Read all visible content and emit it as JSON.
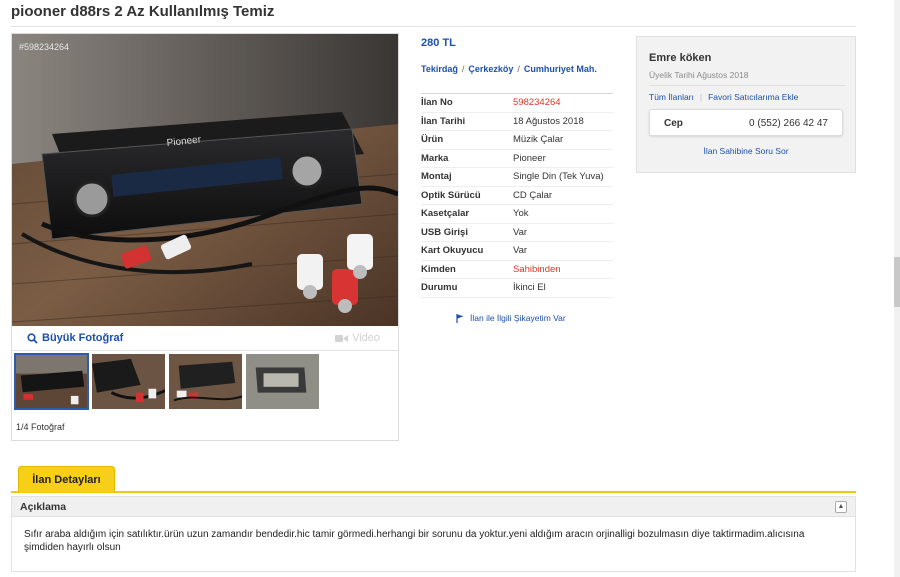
{
  "listing": {
    "title": "piooner d88rs 2 Az Kullanılmış Temiz",
    "photo_id": "#598234264",
    "price": "280 TL",
    "location": {
      "city": "Tekirdağ",
      "district": "Çerkezköy",
      "neighborhood": "Cumhuriyet Mah.",
      "separator": "/"
    },
    "details": [
      {
        "key": "İlan No",
        "value": "598234264",
        "highlight": true
      },
      {
        "key": "İlan Tarihi",
        "value": "18 Ağustos 2018",
        "highlight": false
      },
      {
        "key": "Ürün",
        "value": "Müzik Çalar",
        "highlight": false
      },
      {
        "key": "Marka",
        "value": "Pioneer",
        "highlight": false
      },
      {
        "key": "Montaj",
        "value": "Single Din (Tek Yuva)",
        "highlight": false
      },
      {
        "key": "Optik Sürücü",
        "value": "CD Çalar",
        "highlight": false
      },
      {
        "key": "Kasetçalar",
        "value": "Yok",
        "highlight": false
      },
      {
        "key": "USB Girişi",
        "value": "Var",
        "highlight": false
      },
      {
        "key": "Kart Okuyucu",
        "value": "Var",
        "highlight": false
      },
      {
        "key": "Kimden",
        "value": "Sahibinden",
        "highlight": true
      },
      {
        "key": "Durumu",
        "value": "İkinci El",
        "highlight": false
      }
    ],
    "complaint_link": "İlan ile İlgili Şikayetim Var"
  },
  "gallery": {
    "big_photo_label": "Büyük Fotoğraf",
    "video_label": "Video",
    "photo_count": "1/4 Fotoğraf",
    "thumbnail_count": 4,
    "active_index": 0
  },
  "seller": {
    "name": "Emre köken",
    "member_since": "Üyelik Tarihi Ağustos 2018",
    "all_listings_link": "Tüm İlanları",
    "favorite_link": "Favori Satıcılarıma Ekle",
    "phone_label": "Cep",
    "phone_number": "0 (552) 266 42 47",
    "ask_link": "İlan Sahibine Soru Sor"
  },
  "tabs": {
    "details_label": "İlan Detayları"
  },
  "description": {
    "title": "Açıklama",
    "text": "Sıfır araba aldığım için satılıktır.ürün uzun zamandır bendedir.hic tamir görmedi.herhangi bir sorunu da yoktur.yeni aldığım aracın orjinalligi bozulmasın diye taktirmadim.alıcısına şimdiden hayırlı olsun"
  },
  "colors": {
    "link": "#1c4fb0",
    "highlight": "#e0362a",
    "tab": "#f6cf16"
  },
  "icons": {
    "search": "search-icon",
    "video": "video-camera-icon",
    "flag": "flag-icon",
    "collapse": "chevron-up-icon"
  }
}
